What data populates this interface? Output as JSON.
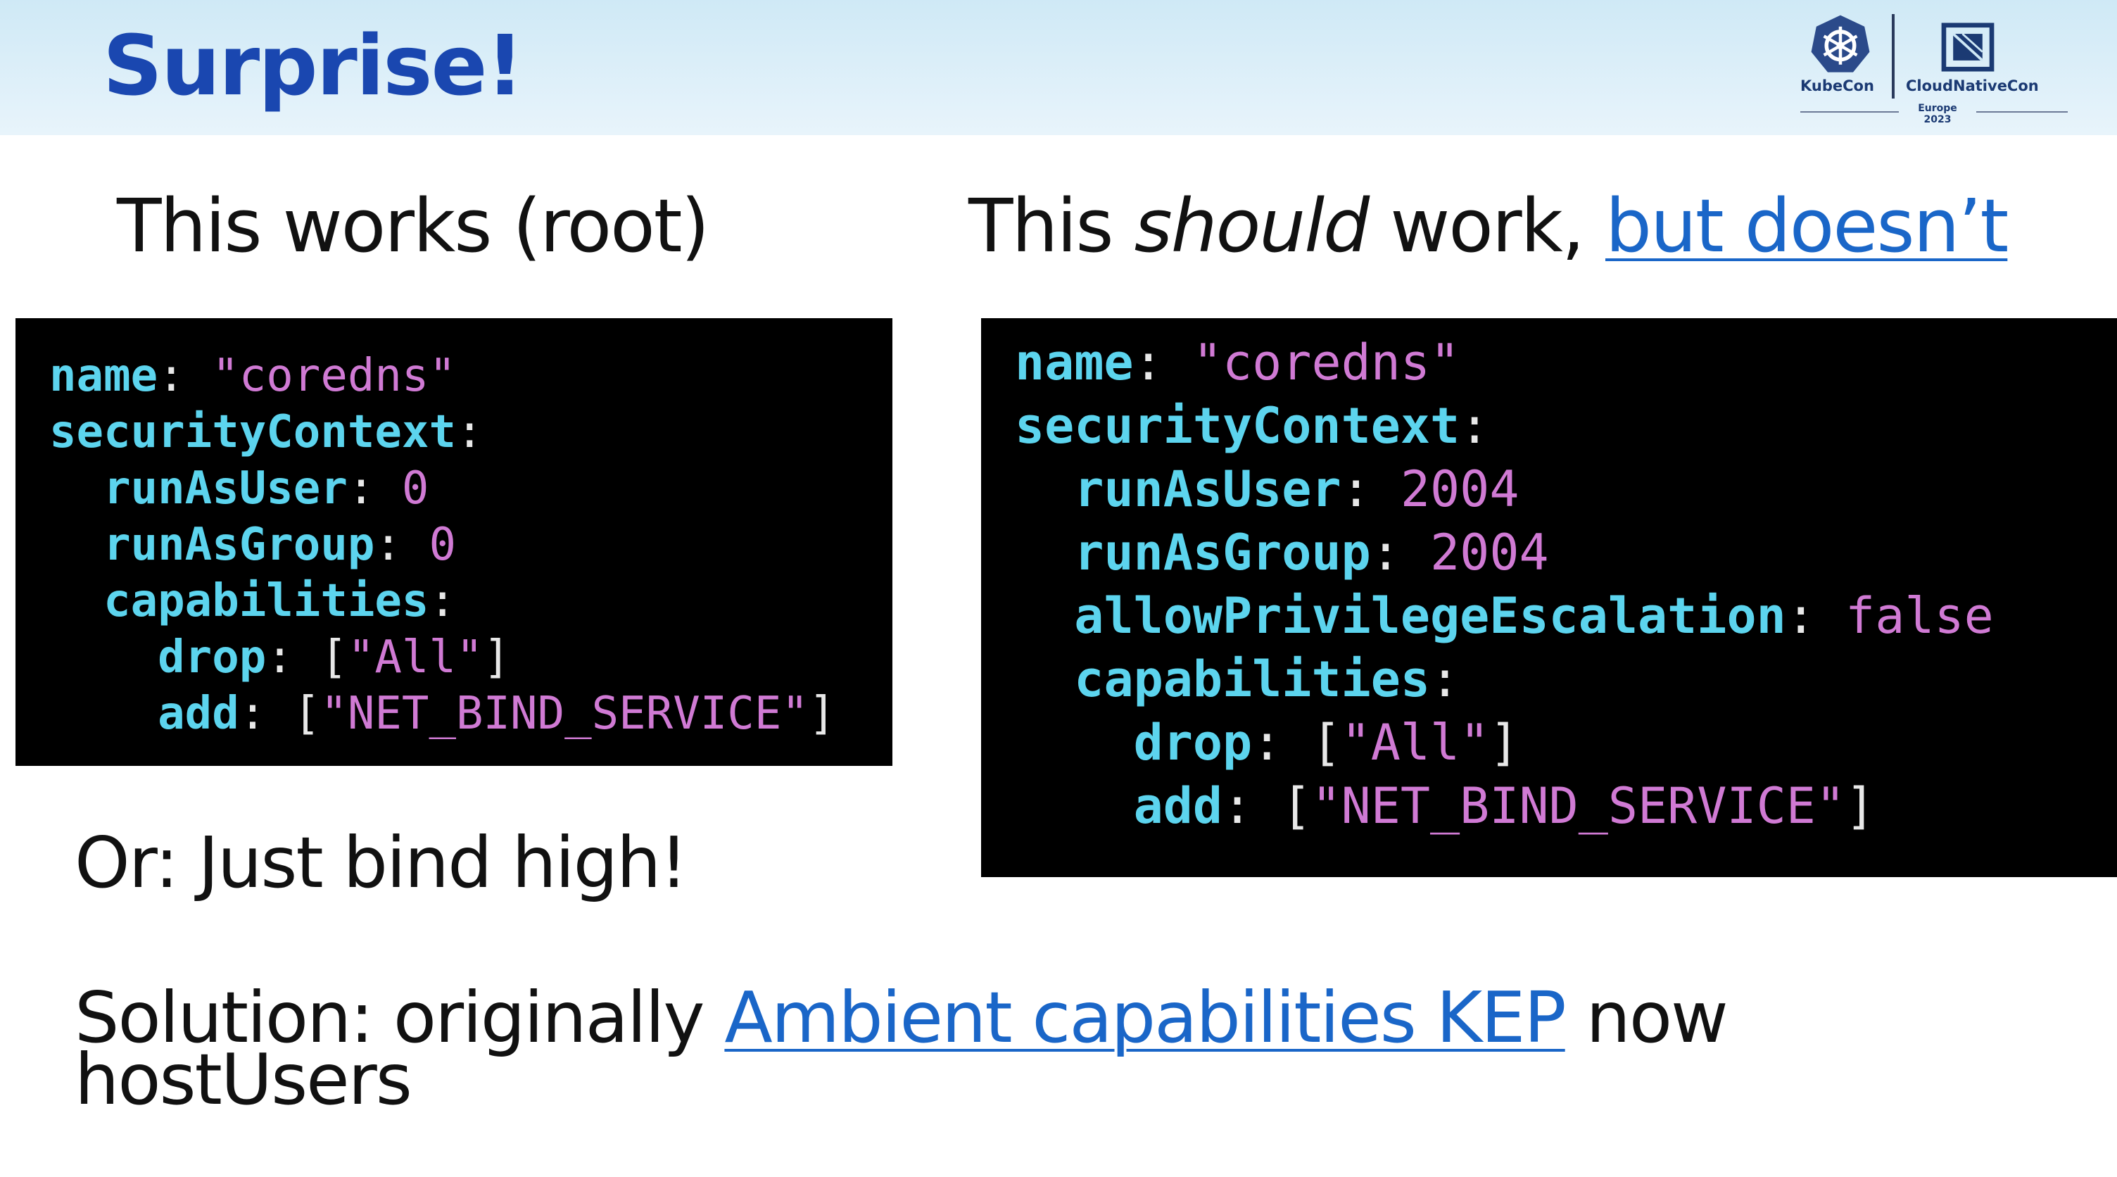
{
  "slide": {
    "title": "Surprise!",
    "logo": {
      "kubecon_label": "KubeCon",
      "cloudnative_label": "CloudNativeCon",
      "event_label": "Europe 2023",
      "kubecon_icon": "helm-wheel-icon",
      "cloudnative_icon": "cncf-square-icon"
    },
    "left_heading": "This works (root)",
    "right_heading": {
      "part1": "This ",
      "emphasis": "should",
      "part2": " work, ",
      "link": "but doesn’t"
    },
    "left_code": [
      {
        "indent": "",
        "key": "name",
        "sep": ": ",
        "value": "\"coredns\""
      },
      {
        "indent": "",
        "key": "securityContext",
        "sep": ":",
        "value": ""
      },
      {
        "indent": "  ",
        "key": "runAsUser",
        "sep": ": ",
        "value": "0"
      },
      {
        "indent": "  ",
        "key": "runAsGroup",
        "sep": ": ",
        "value": "0"
      },
      {
        "indent": "  ",
        "key": "capabilities",
        "sep": ":",
        "value": ""
      },
      {
        "indent": "    ",
        "key": "drop",
        "sep": ": [",
        "value": "\"All\"",
        "close": "]"
      },
      {
        "indent": "    ",
        "key": "add",
        "sep": ": [",
        "value": "\"NET_BIND_SERVICE\"",
        "close": "]"
      }
    ],
    "right_code": [
      {
        "indent": "",
        "key": "name",
        "sep": ": ",
        "value": "\"coredns\""
      },
      {
        "indent": "",
        "key": "securityContext",
        "sep": ":",
        "value": ""
      },
      {
        "indent": "  ",
        "key": "runAsUser",
        "sep": ": ",
        "value": "2004"
      },
      {
        "indent": "  ",
        "key": "runAsGroup",
        "sep": ": ",
        "value": "2004"
      },
      {
        "indent": "  ",
        "key": "allowPrivilegeEscalation",
        "sep": ": ",
        "value": "false"
      },
      {
        "indent": "  ",
        "key": "capabilities",
        "sep": ":",
        "value": ""
      },
      {
        "indent": "    ",
        "key": "drop",
        "sep": ": [",
        "value": "\"All\"",
        "close": "]"
      },
      {
        "indent": "    ",
        "key": "add",
        "sep": ": [",
        "value": "\"NET_BIND_SERVICE\"",
        "close": "]"
      }
    ],
    "or_text": "Or: Just bind high!",
    "solution": {
      "prefix": "Solution: originally ",
      "link": "Ambient capabilities KEP",
      "suffix": " now",
      "line2": "hostUsers"
    },
    "colors": {
      "title": "#1a47b0",
      "link": "#1a66c8",
      "code_key": "#5cd4ee",
      "code_value": "#d07ad4",
      "code_bg": "#000000"
    }
  }
}
